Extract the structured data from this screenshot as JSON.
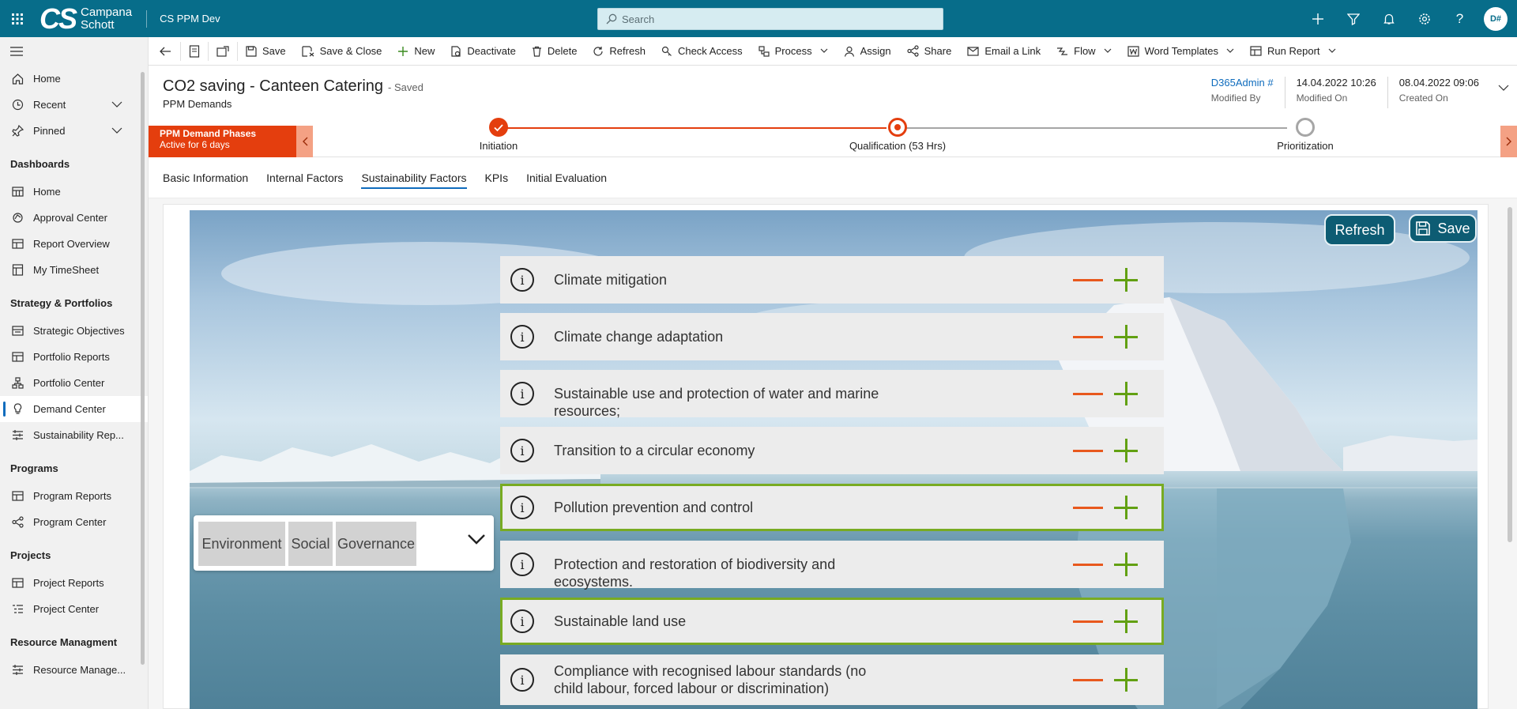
{
  "app": {
    "logo_letters": "CS",
    "logo_name_line1": "Campana",
    "logo_name_line2": "Schott",
    "name": "CS PPM Dev",
    "search_placeholder": "Search",
    "avatar_initials": "D#",
    "top_icons": [
      "plus-icon",
      "filter-icon",
      "bell-icon",
      "gear-icon",
      "help-icon"
    ]
  },
  "sidebar": {
    "items_top": [
      {
        "label": "Home",
        "icon": "home-icon"
      },
      {
        "label": "Recent",
        "icon": "clock-icon",
        "chevron": true
      },
      {
        "label": "Pinned",
        "icon": "pin-icon",
        "chevron": true
      }
    ],
    "groups": [
      {
        "heading": "Dashboards",
        "items": [
          {
            "label": "Home",
            "icon": "grid-icon"
          },
          {
            "label": "Approval Center",
            "icon": "badge-icon"
          },
          {
            "label": "Report Overview",
            "icon": "report-icon"
          },
          {
            "label": "My TimeSheet",
            "icon": "sheet-icon"
          }
        ]
      },
      {
        "heading": "Strategy & Portfolios",
        "items": [
          {
            "label": "Strategic Objectives",
            "icon": "objectives-icon"
          },
          {
            "label": "Portfolio Reports",
            "icon": "report-icon"
          },
          {
            "label": "Portfolio Center",
            "icon": "hierarchy-icon"
          },
          {
            "label": "Demand Center",
            "icon": "lightbulb-icon",
            "active": true
          },
          {
            "label": "Sustainability Rep...",
            "icon": "sustain-icon"
          }
        ]
      },
      {
        "heading": "Programs",
        "items": [
          {
            "label": "Program Reports",
            "icon": "report-icon"
          },
          {
            "label": "Program Center",
            "icon": "share-icon"
          }
        ]
      },
      {
        "heading": "Projects",
        "items": [
          {
            "label": "Project Reports",
            "icon": "report-icon"
          },
          {
            "label": "Project Center",
            "icon": "list-icon"
          }
        ]
      },
      {
        "heading": "Resource Managment",
        "items": [
          {
            "label": "Resource Manage...",
            "icon": "sustain-icon"
          }
        ]
      }
    ]
  },
  "commands": [
    {
      "label": "Save",
      "icon": "save-icon"
    },
    {
      "label": "Save & Close",
      "icon": "save-close-icon"
    },
    {
      "label": "New",
      "icon": "plus-icon"
    },
    {
      "label": "Deactivate",
      "icon": "deactivate-icon"
    },
    {
      "label": "Delete",
      "icon": "trash-icon"
    },
    {
      "label": "Refresh",
      "icon": "refresh-icon"
    },
    {
      "label": "Check Access",
      "icon": "key-icon"
    },
    {
      "label": "Process",
      "icon": "process-icon",
      "dropdown": true
    },
    {
      "label": "Assign",
      "icon": "person-icon"
    },
    {
      "label": "Share",
      "icon": "share-icon"
    },
    {
      "label": "Email a Link",
      "icon": "mail-icon"
    },
    {
      "label": "Flow",
      "icon": "flow-icon",
      "dropdown": true
    },
    {
      "label": "Word Templates",
      "icon": "word-icon",
      "dropdown": true
    },
    {
      "label": "Run Report",
      "icon": "report-icon",
      "dropdown": true
    }
  ],
  "record": {
    "title": "CO2 saving - Canteen Catering",
    "status": "- Saved",
    "entity": "PPM Demands",
    "fields": [
      {
        "value": "D365Admin #",
        "label": "Modified By",
        "link": true
      },
      {
        "value": "14.04.2022 10:26",
        "label": "Modified On"
      },
      {
        "value": "08.04.2022 09:06",
        "label": "Created On"
      }
    ]
  },
  "bpf": {
    "phase_name": "PPM Demand Phases",
    "phase_duration": "Active for 6 days",
    "stages": [
      {
        "label": "Initiation",
        "state": "completed"
      },
      {
        "label": "Qualification  (53 Hrs)",
        "state": "active"
      },
      {
        "label": "Prioritization",
        "state": "pending"
      }
    ],
    "colors": {
      "active": "#e43e0e",
      "pending": "#a6a6a6"
    }
  },
  "tabs": [
    "Basic Information",
    "Internal Factors",
    "Sustainability Factors",
    "KPIs",
    "Initial Evaluation"
  ],
  "active_tab": "Sustainability Factors",
  "panel": {
    "refresh_label": "Refresh",
    "save_label": "Save",
    "esg_tabs": [
      "Environment",
      "Social",
      "Governance"
    ],
    "factors": [
      {
        "label": "Climate mitigation",
        "selected": false
      },
      {
        "label": "Climate change adaptation",
        "selected": false
      },
      {
        "label": "Sustainable use and protection of water and marine resources;",
        "selected": false
      },
      {
        "label": "Transition to a circular economy",
        "selected": false
      },
      {
        "label": "Pollution prevention and control",
        "selected": true
      },
      {
        "label": "Protection and restoration of biodiversity and ecosystems.",
        "selected": false
      },
      {
        "label": "Sustainable land use",
        "selected": true
      },
      {
        "label": "Compliance with recognised labour standards (no child labour, forced labour or discrimination)",
        "selected": false
      }
    ],
    "colors": {
      "minus": "#e8581d",
      "plus": "#62a012",
      "selected_border": "#78ab22"
    }
  }
}
